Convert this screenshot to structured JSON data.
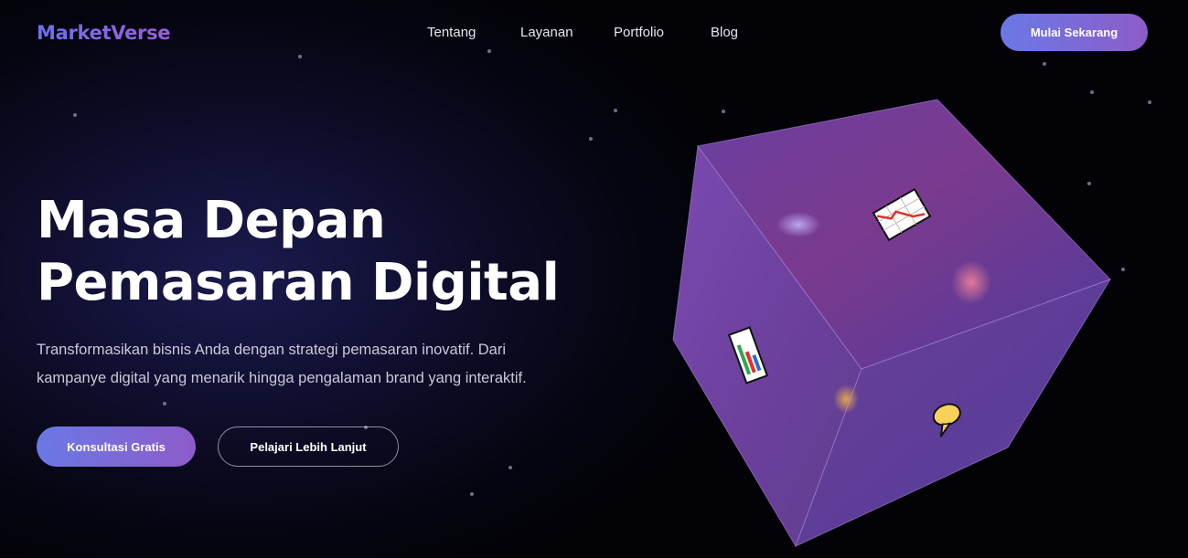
{
  "brand": {
    "logo": "MarketVerse"
  },
  "nav": {
    "items": [
      {
        "label": "Tentang"
      },
      {
        "label": "Layanan"
      },
      {
        "label": "Portfolio"
      },
      {
        "label": "Blog"
      }
    ],
    "cta_label": "Mulai Sekarang"
  },
  "hero": {
    "title_line1": "Masa Depan",
    "title_line2": "Pemasaran Digital",
    "desc_line1": "Transformasikan bisnis Anda dengan strategi pemasaran inovatif. Dari",
    "desc_line2": "kampanye digital yang menarik hingga pengalaman brand yang interaktif.",
    "primary_button": "Konsultasi Gratis",
    "secondary_button": "Pelajari Lebih Lanjut"
  },
  "cube": {
    "icons": [
      "chart-down-icon",
      "bar-chart-icon",
      "speech-bubble-icon"
    ]
  },
  "colors": {
    "accent_start": "#6a78e6",
    "accent_end": "#8d5cc9",
    "background": "#050510"
  }
}
